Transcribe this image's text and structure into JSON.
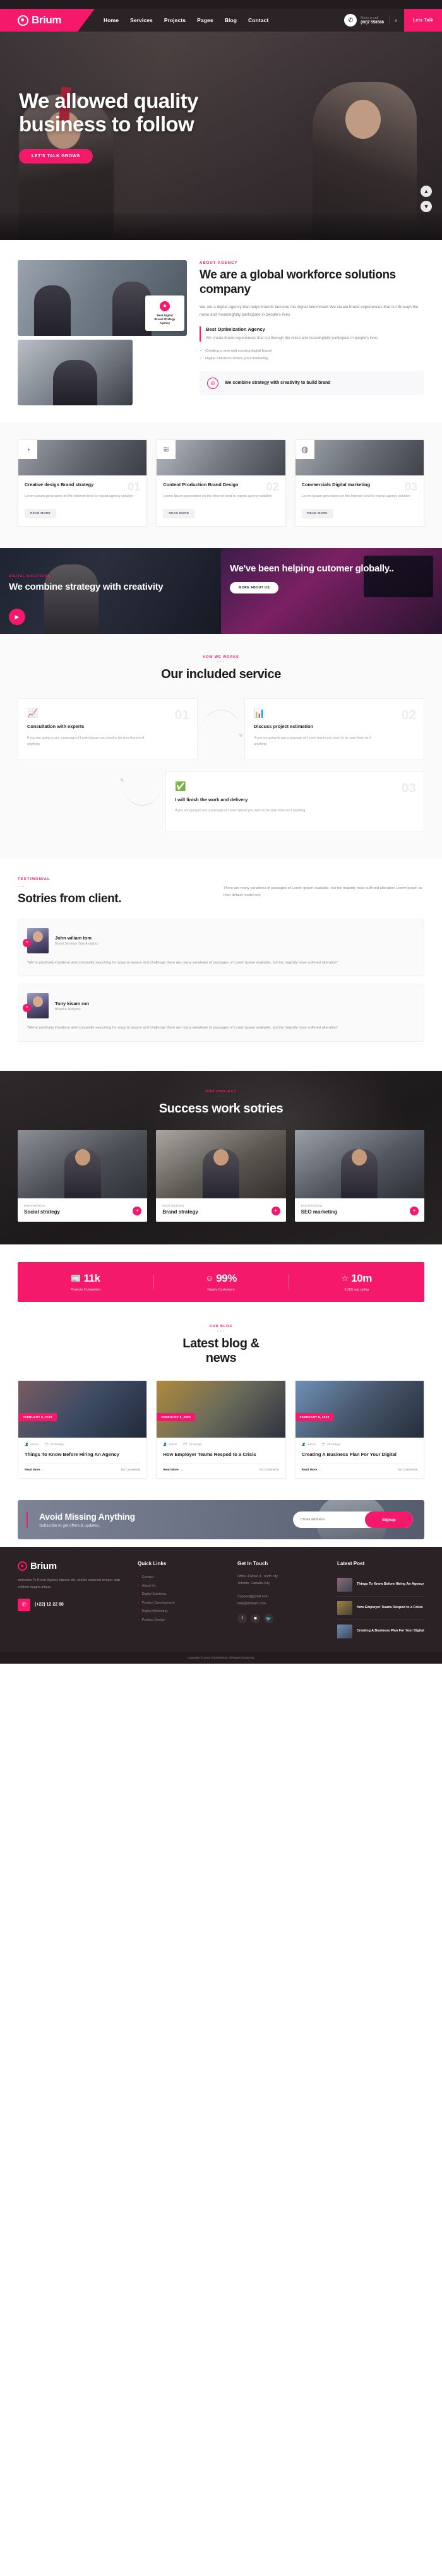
{
  "header": {
    "logo": "Brium",
    "nav": [
      "Home",
      "Services",
      "Projects",
      "Pages",
      "Blog",
      "Contact"
    ],
    "phone_label": "Make a call",
    "phone_number": "(00)7 558568",
    "cta": "Lets Talk",
    "search_icon": "search-icon",
    "phone_icon": "phone-icon"
  },
  "hero": {
    "title_line1": "We allowed quality",
    "title_line2": "business to follow",
    "cta": "LET'S TALK GROWS",
    "arrow_up": "▲",
    "arrow_down": "▼"
  },
  "about": {
    "eyebrow": "ABOUT AGENCY",
    "heading": "We are a global workforce solutions company",
    "paragraph": "We are a digital agency that helps brands become the digital benchmark.We create brand experiences that cut through the noise and meaningfully participate in people's lives",
    "block_title": "Best Optimization Agency",
    "block_text": "We create brand experiences that cut through the noise and meaningfully participate in people's lives",
    "list": [
      "Creating a new and exciting digital brand",
      "Digital Solutions solves your marketing"
    ],
    "badge_line1": "Best Digital",
    "badge_line2": "Brand Strategy",
    "badge_line3": "Agency",
    "combine_title": "We combine strategy with creativity to build brand"
  },
  "services": {
    "cards": [
      {
        "num": "01",
        "icon": "pie-chart-icon",
        "title": "Creative design Brand strategy",
        "text": "Lorem Ipsum generators on the Internet tend to repeat agency solution",
        "button": "READ MORE"
      },
      {
        "num": "02",
        "icon": "layers-icon",
        "title": "Content Production Brand Design",
        "text": "Lorem Ipsum generators on the Internet tend to repeat agency solution",
        "button": "READ MORE"
      },
      {
        "num": "03",
        "icon": "globe-icon",
        "title": "Commercials Digital marketing",
        "text": "Lorem Ipsum generators on the Internet tend to repeat agency solution",
        "button": "READ MORE"
      }
    ]
  },
  "banner": {
    "left_eyebrow": "DIGITAL SOLUTIONS",
    "left_title": "We combine strategy with creativity",
    "play_icon": "play-icon",
    "right_title": "We've been helping cutomer globally..",
    "right_cta": "MORE ABOUT US"
  },
  "included": {
    "eyebrow": "HOW WE WORKS",
    "dots": "• • •",
    "heading": "Our included service",
    "steps": [
      {
        "num": "01",
        "icon": "presentation-chart-icon",
        "title": "Consultation with experts",
        "text": "If you are going to use a passage of Lorem Ipsum you need to be sure there isn't anything"
      },
      {
        "num": "02",
        "icon": "bar-chart-icon",
        "title": "Discuss project estimation",
        "text": "If you are going to use a passage of Lorem Ipsum you need to be sure there isn't anything"
      },
      {
        "num": "03",
        "icon": "check-badge-icon",
        "title": "I will finish the work and delivery",
        "text": "If you are going to use a passage of Lorem Ipsum you need to be sure there isn't anything"
      }
    ]
  },
  "testimonial": {
    "eyebrow": "TESTIMONIAL",
    "dots": "• • •",
    "heading": "Sotries from client.",
    "intro": "There are many variations of passages of Lorem Ipsum available, but the majority have suffered alteration Lorem Ipsum as their default model text",
    "items": [
      {
        "name": "John wiliam tom",
        "role": "Brand Strategy Data Analytics",
        "quote": "\"We're positively impatient and constantly searching for ways to inspire and challenge there are many variations of passages of Lorem Ipsum available, but the majority have suffered alteration\"",
        "quote_icon": "quote-icon"
      },
      {
        "name": "Tony kisam ron",
        "role": "Brand & Analytics",
        "quote": "\"We're positively impatient and constantly searching for ways to inspire and challenge there are many variations of passages of Lorem Ipsum available, but the majority have suffered alteration\"",
        "quote_icon": "quote-icon"
      }
    ]
  },
  "projects": {
    "eyebrow": "OUR PROJECT",
    "dots": "• • •",
    "heading": "Success work sotries",
    "cards": [
      {
        "category": "Brand Marketing",
        "title": "Social strategy",
        "plus_icon": "plus-icon"
      },
      {
        "category": "Brand Marketing",
        "title": "Brand strategy",
        "plus_icon": "plus-icon"
      },
      {
        "category": "Brand Marketing",
        "title": "SEO marketing",
        "plus_icon": "plus-icon"
      }
    ]
  },
  "stats": [
    {
      "icon": "newspaper-icon",
      "value": "11k",
      "label": "Projects Completed"
    },
    {
      "icon": "smile-icon",
      "value": "99%",
      "label": "Happy Customers"
    },
    {
      "icon": "star-icon",
      "value": "10m",
      "label": "3,280 avg rating"
    }
  ],
  "blog": {
    "eyebrow": "OUR BLOG",
    "dots": "• • •",
    "heading_line1": "Latest blog &",
    "heading_line2": "news",
    "posts": [
      {
        "date": "FEBRUARY 8, 2023",
        "author": "admin",
        "category": "All Design",
        "title": "Things To Know Before Hiring An Agency",
        "read_more": "Read More →",
        "comments": "No Comments"
      },
      {
        "date": "FEBRUARY 8, 2023",
        "author": "admin",
        "category": "All Design",
        "title": "How Employer Teams Respod to a Crisis",
        "read_more": "Read More →",
        "comments": "No Comments"
      },
      {
        "date": "FEBRUARY 8, 2023",
        "author": "admin",
        "category": "All Design",
        "title": "Creating A Business Plan For Your Digital",
        "read_more": "Read More →",
        "comments": "No Comments"
      }
    ]
  },
  "newsletter": {
    "title": "Avoid Missing Anything",
    "subtitle": "Subscribe to get offers & updates.",
    "placeholder": "Email address",
    "button": "Signup"
  },
  "footer": {
    "logo": "Brium",
    "about": "wellcome To Brium Agency dipnisc elit, sed do eiusmod tempor ulab edolore magna aliqua.",
    "phone": "(+22) 12 22 88",
    "quick_links_title": "Quick Links",
    "quick_links": [
      "Contact",
      "About Us",
      "Digital Solutions",
      "Product Development",
      "Digital Marketing",
      "Product Design"
    ],
    "touch_title": "Get In Touch",
    "address_line1": "Office 4 Road 3 , north city",
    "address_line2": "Toronto, Canada City",
    "email1": "Support@gmail.com",
    "email2": "help@domain.com",
    "social": [
      "facebook-icon",
      "instagram-icon",
      "twitter-icon"
    ],
    "latest_title": "Latest Post",
    "latest_posts": [
      "Things To Know Before Hiring An Agency",
      "How Employer Teams Respod to a Crisis",
      "Creating A Business Plan For Your Digital"
    ],
    "copyright": "Copyright © 2023 Themeforest. All Rights Reserved."
  }
}
